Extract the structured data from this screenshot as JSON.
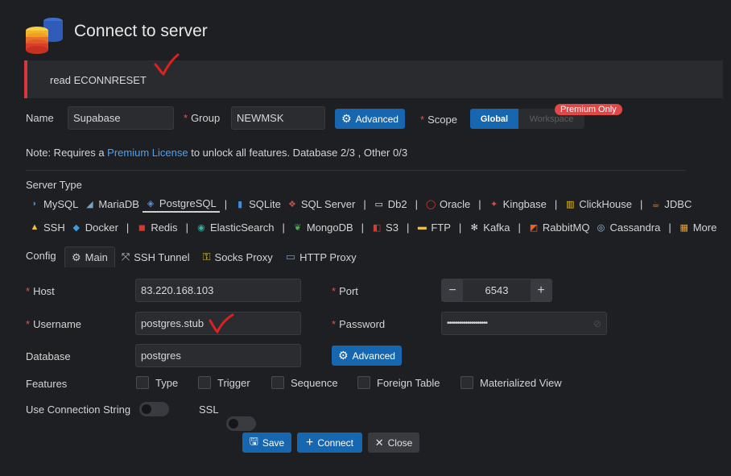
{
  "header": {
    "title": "Connect to server",
    "logo_icon": "database-stack-icon"
  },
  "error": {
    "message": "read ECONNRESET",
    "accent": "#d9363e"
  },
  "top_form": {
    "name_label": "Name",
    "name_value": "Supabase",
    "group_label": "Group",
    "group_value": "NEWMSK",
    "advanced_label": "Advanced",
    "scope_label": "Scope",
    "scope_options": [
      "Global",
      "Workspace"
    ],
    "scope_selected": "Global",
    "premium_badge": "Premium Only"
  },
  "note": {
    "prefix": "Note: Requires a ",
    "link": "Premium License",
    "suffix": " to unlock all features. Database 2/3 , Other 0/3"
  },
  "server_type": {
    "label": "Server Type",
    "selected": "PostgreSQL",
    "row1": [
      {
        "label": "MySQL",
        "icon": "mysql-icon",
        "color": "#4a7fb0"
      },
      {
        "label": "MariaDB",
        "icon": "mariadb-icon",
        "color": "#6fa6c8"
      },
      {
        "label": "PostgreSQL",
        "icon": "postgresql-icon",
        "color": "#5d8fd0"
      },
      {
        "label": "SQLite",
        "icon": "sqlite-icon",
        "color": "#3c8ee0"
      },
      {
        "label": "SQL Server",
        "icon": "sqlserver-icon",
        "color": "#c0504a"
      },
      {
        "label": "Db2",
        "icon": "db2-icon",
        "color": "#e0e0e0"
      },
      {
        "label": "Oracle",
        "icon": "oracle-icon",
        "color": "#e0352b"
      },
      {
        "label": "Kingbase",
        "icon": "kingbase-icon",
        "color": "#e04848"
      },
      {
        "label": "ClickHouse",
        "icon": "clickhouse-icon",
        "color": "#f5c518"
      },
      {
        "label": "JDBC",
        "icon": "jdbc-icon",
        "color": "#c08040"
      }
    ],
    "row2": [
      {
        "label": "SSH",
        "icon": "ssh-icon",
        "color": "#f0c040"
      },
      {
        "label": "Docker",
        "icon": "docker-icon",
        "color": "#3a9be0"
      },
      {
        "label": "Redis",
        "icon": "redis-icon",
        "color": "#d8382c"
      },
      {
        "label": "ElasticSearch",
        "icon": "elasticsearch-icon",
        "color": "#30b0a0"
      },
      {
        "label": "MongoDB",
        "icon": "mongodb-icon",
        "color": "#4caf50"
      },
      {
        "label": "S3",
        "icon": "s3-icon",
        "color": "#d04030"
      },
      {
        "label": "FTP",
        "icon": "folder-icon",
        "color": "#f0c040"
      },
      {
        "label": "Kafka",
        "icon": "kafka-icon",
        "color": "#e0e0e0"
      },
      {
        "label": "RabbitMQ",
        "icon": "rabbitmq-icon",
        "color": "#f06020"
      },
      {
        "label": "Cassandra",
        "icon": "cassandra-icon",
        "color": "#a0c0e0"
      },
      {
        "label": "More",
        "icon": "grid-icon",
        "color": "#f0a030"
      }
    ]
  },
  "config": {
    "label": "Config",
    "tabs": [
      {
        "label": "Main",
        "icon": "gear-icon"
      },
      {
        "label": "SSH Tunnel",
        "icon": "tunnel-icon"
      },
      {
        "label": "Socks Proxy",
        "icon": "proxy-icon"
      },
      {
        "label": "HTTP Proxy",
        "icon": "http-proxy-icon"
      }
    ],
    "active_tab": "Main"
  },
  "main": {
    "host_label": "Host",
    "host_value": "83.220.168.103",
    "port_label": "Port",
    "port_value": "6543",
    "port_minus": "−",
    "port_plus": "+",
    "username_label": "Username",
    "username_value": "postgres.stub",
    "password_label": "Password",
    "password_value": "••••••••••••••••••••",
    "database_label": "Database",
    "database_value": "postgres",
    "advanced_label": "Advanced",
    "features_label": "Features",
    "features": [
      "Type",
      "Trigger",
      "Sequence",
      "Foreign Table",
      "Materialized View"
    ],
    "use_conn_string_label": "Use Connection String",
    "ssl_label": "SSL"
  },
  "footer": {
    "save_label": "Save",
    "connect_label": "Connect",
    "close_label": "Close"
  }
}
